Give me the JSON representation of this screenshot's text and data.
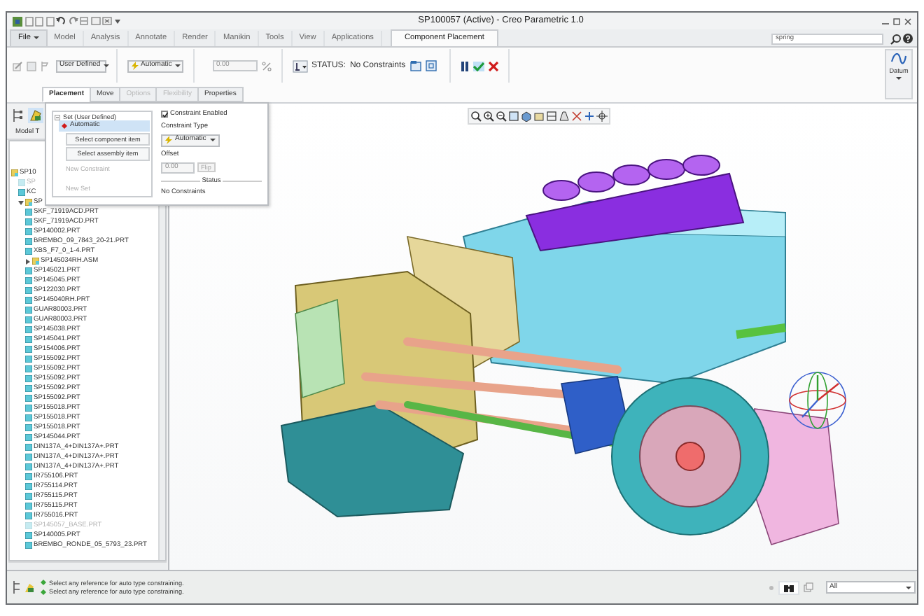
{
  "window": {
    "title": "SP100057 (Active) - Creo Parametric 1.0"
  },
  "menu_tabs": [
    {
      "label": "File",
      "selected": false,
      "kind": "menu"
    },
    {
      "label": "Model",
      "selected": false,
      "kind": "tab"
    },
    {
      "label": "Analysis",
      "selected": false,
      "kind": "tab"
    },
    {
      "label": "Annotate",
      "selected": false,
      "kind": "tab"
    },
    {
      "label": "Render",
      "selected": false,
      "kind": "tab"
    },
    {
      "label": "Manikin",
      "selected": false,
      "kind": "tab"
    },
    {
      "label": "Tools",
      "selected": false,
      "kind": "tab"
    },
    {
      "label": "View",
      "selected": false,
      "kind": "tab"
    },
    {
      "label": "Applications",
      "selected": false,
      "kind": "tab"
    },
    {
      "label": "Component Placement",
      "selected": true,
      "kind": "tab"
    }
  ],
  "search": {
    "value": "spring"
  },
  "ribbon": {
    "reference_set": "User Defined",
    "constraint_type": "Automatic",
    "offset": {
      "value": "0.00",
      "disabled": true
    },
    "status_label": "STATUS:",
    "status_value": "No Constraints",
    "datum_group": "Datum"
  },
  "panel_tabs": [
    {
      "label": "Placement",
      "selected": true,
      "disabled": false
    },
    {
      "label": "Move",
      "selected": false,
      "disabled": false
    },
    {
      "label": "Options",
      "selected": false,
      "disabled": true
    },
    {
      "label": "Flexibility",
      "selected": false,
      "disabled": true
    },
    {
      "label": "Properties",
      "selected": false,
      "disabled": false
    }
  ],
  "placement_panel": {
    "set_label": "Set (User Defined)",
    "constraints": [
      {
        "label": "Automatic",
        "selected": true
      }
    ],
    "buttons": [
      "Select component item",
      "Select assembly item"
    ],
    "new_constraint": "New Constraint",
    "new_set": "New Set",
    "constraint_enabled": {
      "label": "Constraint Enabled",
      "checked": true
    },
    "constraint_type_label": "Constraint Type",
    "constraint_type": "Automatic",
    "offset_label": "Offset",
    "offset": {
      "value": "0.00",
      "disabled": true
    },
    "flip": "Flip",
    "status_label": "Status",
    "status_value": "No Constraints"
  },
  "model_tree": {
    "header": "Model T",
    "items": [
      {
        "label": "SP10",
        "kind": "assembly",
        "dimmed": false,
        "children": [
          {
            "label": "SP",
            "kind": "part",
            "dimmed": true
          },
          {
            "label": "KC",
            "kind": "part",
            "dimmed": false
          },
          {
            "label": "SP",
            "kind": "assembly",
            "dimmed": false,
            "expanded": true,
            "children": [
              {
                "label": "SKF_71919ACD.PRT",
                "kind": "part",
                "dimmed": false
              },
              {
                "label": "SKF_71919ACD.PRT",
                "kind": "part",
                "dimmed": false
              },
              {
                "label": "SP140002.PRT",
                "kind": "part",
                "dimmed": false
              },
              {
                "label": "BREMBO_09_7843_20-21.PRT",
                "kind": "part",
                "dimmed": false
              },
              {
                "label": "XBS_F7_0_1-4.PRT",
                "kind": "part",
                "dimmed": false
              },
              {
                "label": "SP145034RH.ASM",
                "kind": "assembly",
                "dimmed": false,
                "expanded": false
              },
              {
                "label": "SP145021.PRT",
                "kind": "part",
                "dimmed": false
              },
              {
                "label": "SP145045.PRT",
                "kind": "part",
                "dimmed": false
              },
              {
                "label": "SP122030.PRT",
                "kind": "part",
                "dimmed": false
              },
              {
                "label": "SP145040RH.PRT",
                "kind": "part",
                "dimmed": false
              },
              {
                "label": "GUAR80003.PRT",
                "kind": "part",
                "dimmed": false
              },
              {
                "label": "GUAR80003.PRT",
                "kind": "part",
                "dimmed": false
              },
              {
                "label": "SP145038.PRT",
                "kind": "part",
                "dimmed": false
              },
              {
                "label": "SP145041.PRT",
                "kind": "part",
                "dimmed": false
              },
              {
                "label": "SP154006.PRT",
                "kind": "part",
                "dimmed": false
              },
              {
                "label": "SP155092.PRT",
                "kind": "part",
                "dimmed": false
              },
              {
                "label": "SP155092.PRT",
                "kind": "part",
                "dimmed": false
              },
              {
                "label": "SP155092.PRT",
                "kind": "part",
                "dimmed": false
              },
              {
                "label": "SP155092.PRT",
                "kind": "part",
                "dimmed": false
              },
              {
                "label": "SP155092.PRT",
                "kind": "part",
                "dimmed": false
              },
              {
                "label": "SP155018.PRT",
                "kind": "part",
                "dimmed": false
              },
              {
                "label": "SP155018.PRT",
                "kind": "part",
                "dimmed": false
              },
              {
                "label": "SP155018.PRT",
                "kind": "part",
                "dimmed": false
              },
              {
                "label": "SP145044.PRT",
                "kind": "part",
                "dimmed": false
              },
              {
                "label": "DIN137A_4+DIN137A+.PRT",
                "kind": "part",
                "dimmed": false
              },
              {
                "label": "DIN137A_4+DIN137A+.PRT",
                "kind": "part",
                "dimmed": false
              },
              {
                "label": "DIN137A_4+DIN137A+.PRT",
                "kind": "part",
                "dimmed": false
              },
              {
                "label": "IR755106.PRT",
                "kind": "part",
                "dimmed": false
              },
              {
                "label": "IR755114.PRT",
                "kind": "part",
                "dimmed": false
              },
              {
                "label": "IR755115.PRT",
                "kind": "part",
                "dimmed": false
              },
              {
                "label": "IR755115.PRT",
                "kind": "part",
                "dimmed": false
              },
              {
                "label": "IR755016.PRT",
                "kind": "part",
                "dimmed": false
              },
              {
                "label": "SP145057_BASE.PRT",
                "kind": "part",
                "dimmed": true
              },
              {
                "label": "SP140005.PRT",
                "kind": "part",
                "dimmed": false
              },
              {
                "label": "BREMBO_RONDE_05_5793_23.PRT",
                "kind": "part",
                "dimmed": false
              }
            ]
          }
        ]
      }
    ]
  },
  "status_bar": {
    "messages": [
      "Select any reference for auto type constraining.",
      "Select any reference for auto type constraining."
    ],
    "filter": "All"
  }
}
